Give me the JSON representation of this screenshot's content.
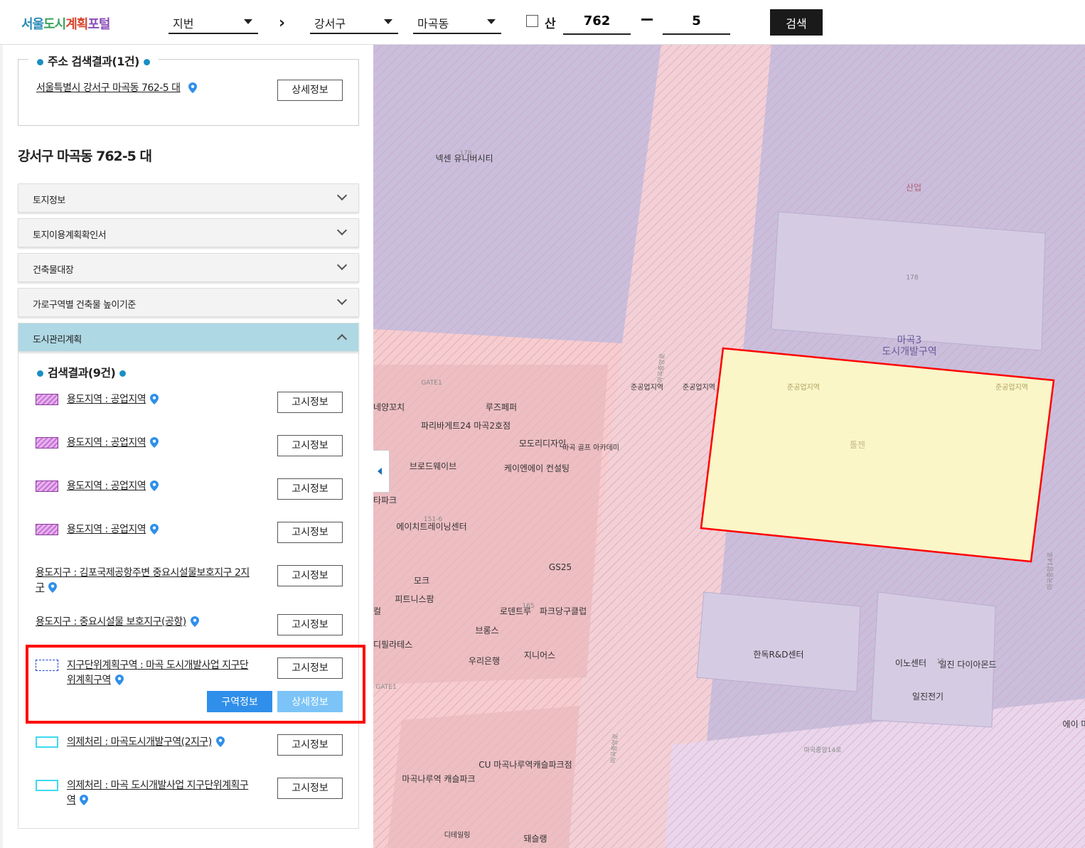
{
  "header": {
    "logo": {
      "part1": "서울",
      "part2": "도시",
      "part3": "계획",
      "part4": "포털"
    },
    "search_type": "지번",
    "district": "강서구",
    "dong": "마곡동",
    "san_label": "산",
    "main_no": "762",
    "sub_no": "5",
    "search_button": "검색"
  },
  "address_result": {
    "title": "주소 검색결과(1건)",
    "address": "서울특별시 강서구 마곡동 762-5 대",
    "detail_button": "상세정보"
  },
  "parcel_title": "강서구 마곡동 762-5 대",
  "accordions": [
    {
      "label": "토지정보"
    },
    {
      "label": "토지이용계획확인서"
    },
    {
      "label": "건축물대장"
    },
    {
      "label": "가로구역별 건축물 높이기준"
    },
    {
      "label": "도시관리계획"
    }
  ],
  "plan_results": {
    "title": "검색결과(9건)",
    "items": [
      {
        "text": "용도지역 : 공업지역",
        "button": "고시정보"
      },
      {
        "text": "용도지역 : 공업지역",
        "button": "고시정보"
      },
      {
        "text": "용도지역 : 공업지역",
        "button": "고시정보"
      },
      {
        "text": "용도지역 : 공업지역",
        "button": "고시정보"
      },
      {
        "text": "용도지구 : 김포국제공항주변 중요시설물보호지구 2지구",
        "button": "고시정보"
      },
      {
        "text": "용도지구 : 중요시설물 보호지구(공항)",
        "button": "고시정보"
      },
      {
        "text": "지구단위계획구역 : 마곡 도시개발사업 지구단위계획구역",
        "button": "고시정보",
        "area_button": "구역정보",
        "detail_button": "상세정보"
      },
      {
        "text": "의제처리 : 마곡도시개발구역(2지구)",
        "button": "고시정보"
      },
      {
        "text": "의제처리 : 마곡 도시개발사업 지구단위계획구역",
        "button": "고시정보"
      }
    ]
  },
  "map": {
    "labels": {
      "nexen": "넥센 유니버시티",
      "sanup": "산업",
      "magok3": "마곡3",
      "dosigaebal": "도시개발구역",
      "jungongup1": "준공업지역",
      "jungongup2": "준공업지역",
      "jungongup3": "준공업지역",
      "jungongup4": "준공업지역",
      "tongjeon": "톨젠",
      "gate1_top": "GATE1",
      "gate1_bottom": "GATE1",
      "yanggochi": "네양꼬치",
      "lujepe": "루즈페퍼",
      "paris": "파리바게트24 마곡2호점",
      "modori": "모도리디자인",
      "golf": "마곡 골프 아카데미",
      "broad": "브로드웨이브",
      "kei": "케이엔에이 컨설팅",
      "tapa": "타파크",
      "hcenter": "에이치트레이닝센터",
      "gs25": "GS25",
      "mok": "모크",
      "pitness": "피트니스팜",
      "lodentu": "로덴트루",
      "parkdang": "파크당구클럽",
      "kal": "컬",
      "brons": "브롱스",
      "pilates": "디필라테스",
      "woori": "우리은행",
      "genius": "지니어스",
      "hanrd": "한독R&D센터",
      "ino": "이노센터",
      "iljin_dia": "일진 다이아몬드",
      "iljin_elec": "일진전기",
      "magok_nr": "마곡나루역 캐슬파크",
      "cu": "CU 마곡나루역캐슬파크점",
      "detailing": "디테일링",
      "dwaesulraeng": "돼슬랭",
      "rd14_a": "마곡중앙14로",
      "rd14_b": "마곡중앙14로",
      "rd_v1": "마곡중앙로",
      "rd_v2": "마곡중앙로",
      "num178a": "178",
      "num178b": "178",
      "num165": "165",
      "num15": "15",
      "num151": "151-6",
      "emi": "에이 마"
    }
  }
}
